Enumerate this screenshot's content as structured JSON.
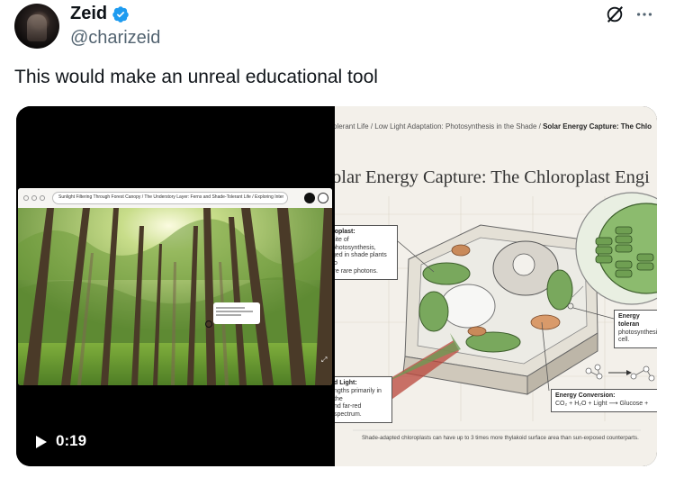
{
  "post": {
    "display_name": "Zeid",
    "handle": "@charizeid",
    "text": "This would make an unreal educational tool",
    "verified_color": "#1d9bf0",
    "icons": {
      "grok": "grok-slash-icon",
      "more": "more-dots-icon",
      "verified": "verified-badge-icon"
    }
  },
  "video": {
    "timestamp": "0:19",
    "browser_url": "Sunlight Filtering Through Forest Canopy / The Understory Layer: Ferns and Shade-Tolerant Life / Exploring Intermittent Light on the Ground"
  },
  "image": {
    "breadcrumb": [
      "olerant Life",
      "Low Light Adaptation: Photosynthesis in the Shade"
    ],
    "breadcrumb_current": "Solar Energy Capture: The Chlo",
    "title": "olar Energy Capture: The Chloroplast Engi",
    "labels": {
      "chloroplast_head": "roplast:",
      "chloroplast_body": [
        "site of photosynthesis,",
        "ged in shade plants to",
        "ire rare photons."
      ],
      "light_head": "d Light:",
      "light_body": [
        "ngths primarily in the",
        "nd far-red spectrum."
      ],
      "tolerant_head": "Energy toleran",
      "tolerant_body": [
        "photosynthesi",
        "cell."
      ],
      "energy_head": "Energy Conversion:",
      "energy_equation": "CO₂ + H₂O + Light ⟶ Glucose +"
    },
    "caption": "Shade-adapted chloroplasts can have up to 3 times more thylakoid surface area than sun-exposed counterparts."
  }
}
